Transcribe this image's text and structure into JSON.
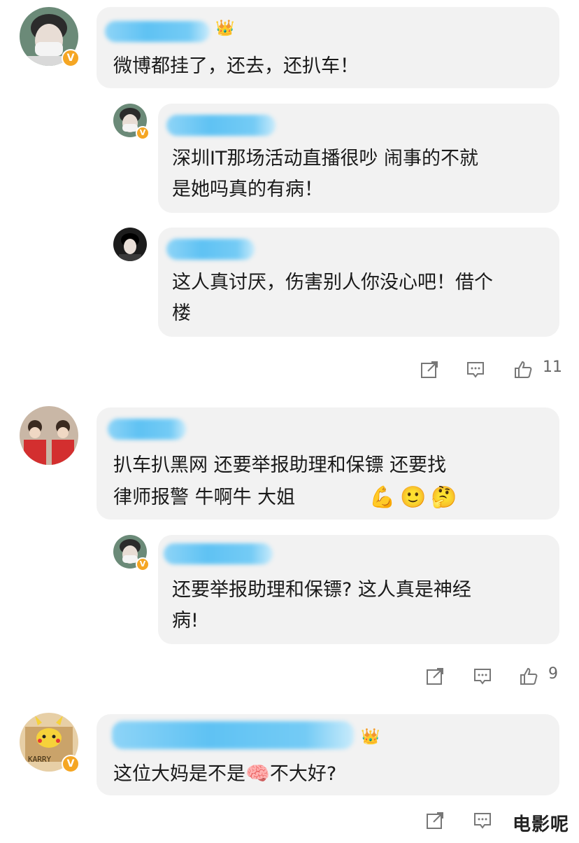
{
  "threads": [
    {
      "comment": {
        "text": "微博都挂了，还去，还扒车！"
      },
      "replies": [
        {
          "line1": "深圳IT那场活动直播很吵 闹事的不就",
          "line2": "是她吗真的有病！"
        },
        {
          "line1": "这人真讨厌，伤害别人你没心吧！借个",
          "line2": "楼"
        }
      ],
      "likes": "11"
    },
    {
      "comment": {
        "line1": "扒车扒黑网    还要举报助理和保镖     还要找",
        "line2": "律师报警      牛啊牛  大姐"
      },
      "emojis": [
        "💪",
        "🙂",
        "🤔"
      ],
      "replies": [
        {
          "line1": "还要举报助理和保镖? 这人真是神经",
          "line2": "病!"
        }
      ],
      "likes": "9"
    },
    {
      "comment": {
        "before": "这位大妈是不是",
        "emoji": "🧠",
        "after": "不大好?"
      },
      "avatar_text": "KARRY"
    }
  ],
  "badges": {
    "verified": "V",
    "crown1": "1",
    "crown2": "6"
  },
  "icons": [
    "share-icon",
    "comment-icon",
    "like-icon"
  ],
  "watermark": "电影呢",
  "colors": {
    "bubble": "#f2f2f2",
    "blur": "#5fc2f3",
    "verified": "#f5a623"
  }
}
